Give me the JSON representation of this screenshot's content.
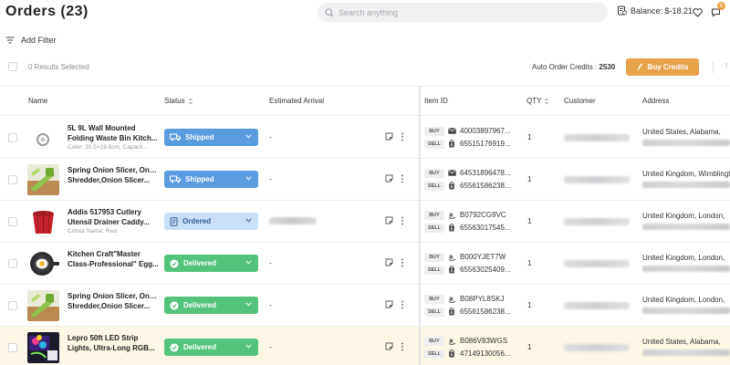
{
  "header": {
    "title": "Orders (23)",
    "search_placeholder": "Search anything",
    "balance_label": "Balance: $-18.21",
    "chat_badge": "6"
  },
  "filter": {
    "add_filter_label": "Add Filter"
  },
  "actions": {
    "results_selected": "0 Results Selected",
    "credits_label": "Auto Order Credits :",
    "credits_value": "2530",
    "buy_credits_label": "Buy Credits",
    "trail": "I"
  },
  "columns": {
    "name": "Name",
    "status": "Status",
    "arrival": "Estimated Arrival",
    "item_id": "Item ID",
    "qty": "QTY",
    "customer": "Customer",
    "address": "Address"
  },
  "tags": {
    "buy": "BUY",
    "sell": "SELL"
  },
  "colors": {
    "accent": "#e8a24a",
    "shipped": "#5b9be0",
    "ordered": "#c9dff8",
    "delivered": "#54c47a",
    "highlight_row": "#fdf7e6"
  },
  "rows": [
    {
      "name_1": "5L 9L Wall Mounted",
      "name_2": "Folding Waste Bin Kitch...",
      "meta": "Color: 20.5×19.5cm, Capacit...",
      "status": "Shipped",
      "arrival": "-",
      "buy_id": "40003897967...",
      "sell_id": "65515176919...",
      "buy_src": "mail-icon",
      "qty": "1",
      "address": "United States, Alabama,"
    },
    {
      "name_1": "Spring Onion Slicer, Onion",
      "name_2": "Shredder,Onion Slicer...",
      "meta": "",
      "status": "Shipped",
      "arrival": "-",
      "buy_id": "64531896478...",
      "sell_id": "65561586238...",
      "buy_src": "mail-icon",
      "qty": "1",
      "address": "United Kingdom, Wimblingt"
    },
    {
      "name_1": "Addis 517953 Cutlery",
      "name_2": "Utensil Drainer Caddy...",
      "meta": "Colour Name: Red",
      "status": "Ordered",
      "arrival": "",
      "buy_id": "B0792CG9VC",
      "sell_id": "65563017545...",
      "buy_src": "amazon-icon",
      "qty": "1",
      "address": "United Kingdom, London,"
    },
    {
      "name_1": "Kitchen Craft\"Master",
      "name_2": "Class-Professional\" Egg...",
      "meta": "",
      "status": "Delivered",
      "arrival": "-",
      "buy_id": "B000YJET7W",
      "sell_id": "65563025409...",
      "buy_src": "amazon-icon",
      "qty": "1",
      "address": "United Kingdom, London,"
    },
    {
      "name_1": "Spring Onion Slicer, Onion",
      "name_2": "Shredder,Onion Slicer...",
      "meta": "",
      "status": "Delivered",
      "arrival": "-",
      "buy_id": "B08PYL8SKJ",
      "sell_id": "65561586238...",
      "buy_src": "amazon-icon",
      "qty": "1",
      "address": "United Kingdom, London,"
    },
    {
      "name_1": "Lepro 50ft LED Strip",
      "name_2": "Lights, Ultra-Long RGB...",
      "meta": "",
      "status": "Delivered",
      "arrival": "-",
      "buy_id": "B086V83WGS",
      "sell_id": "47149130056...",
      "buy_src": "amazon-icon",
      "qty": "1",
      "address": "United States, Alabama,"
    }
  ]
}
